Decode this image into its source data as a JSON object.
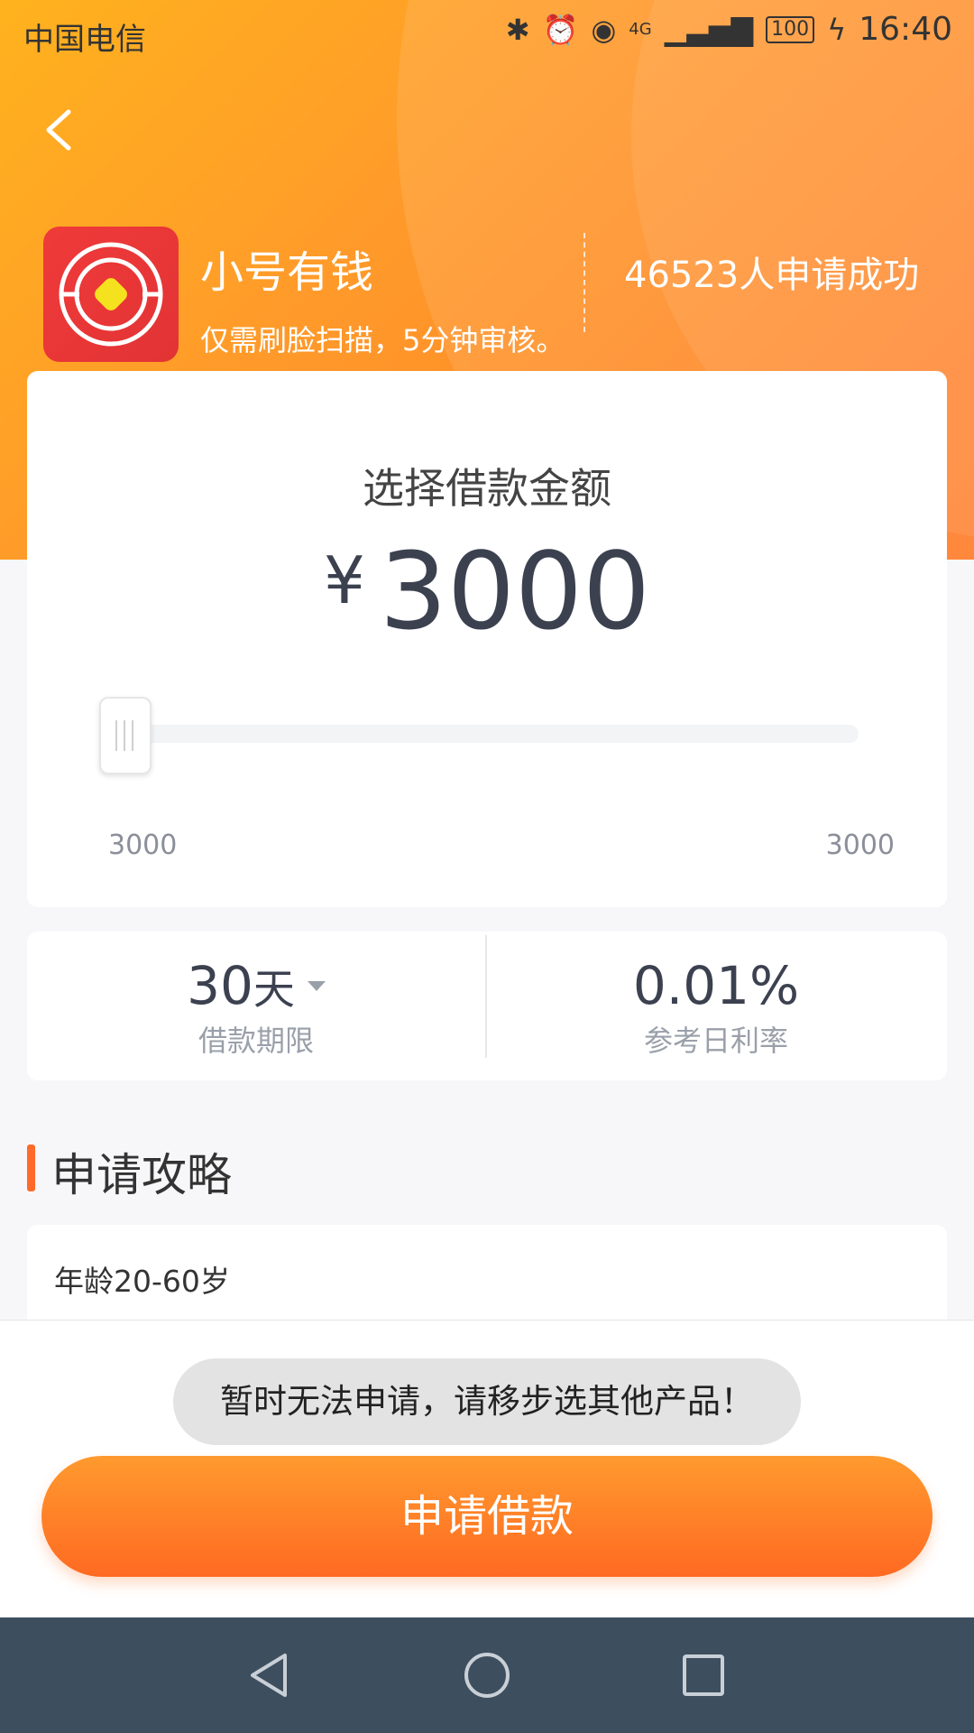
{
  "status_bar": {
    "carrier": "中国电信",
    "battery": "100",
    "time": "16:40",
    "network": "4G"
  },
  "header": {
    "product_name": "小号有钱",
    "product_desc": "仅需刷脸扫描，5分钟审核。",
    "success_count_text": "46523人申请成功"
  },
  "amount": {
    "title": "选择借款金额",
    "currency": "¥",
    "value": "3000",
    "slider_min": "3000",
    "slider_max": "3000",
    "slider_level": 0
  },
  "terms": {
    "period_value": "30",
    "period_unit": "天",
    "period_label": "借款期限",
    "rate_value": "0.01%",
    "rate_label": "参考日利率"
  },
  "strategy": {
    "title": "申请攻略",
    "items": [
      "年龄20-60岁"
    ]
  },
  "bottom": {
    "toast": "暂时无法申请，请移步选其他产品！",
    "apply_button": "申请借款"
  },
  "colors": {
    "accent": "#ff7a26",
    "header_start": "#ffb21e",
    "nav_bar": "#3d4e5e"
  },
  "icons": [
    "back-arrow-icon",
    "bluetooth-icon",
    "alarm-icon",
    "eye-icon",
    "signal-icon",
    "battery-icon",
    "charging-icon",
    "nav-back-icon",
    "nav-home-icon",
    "nav-recent-icon"
  ]
}
